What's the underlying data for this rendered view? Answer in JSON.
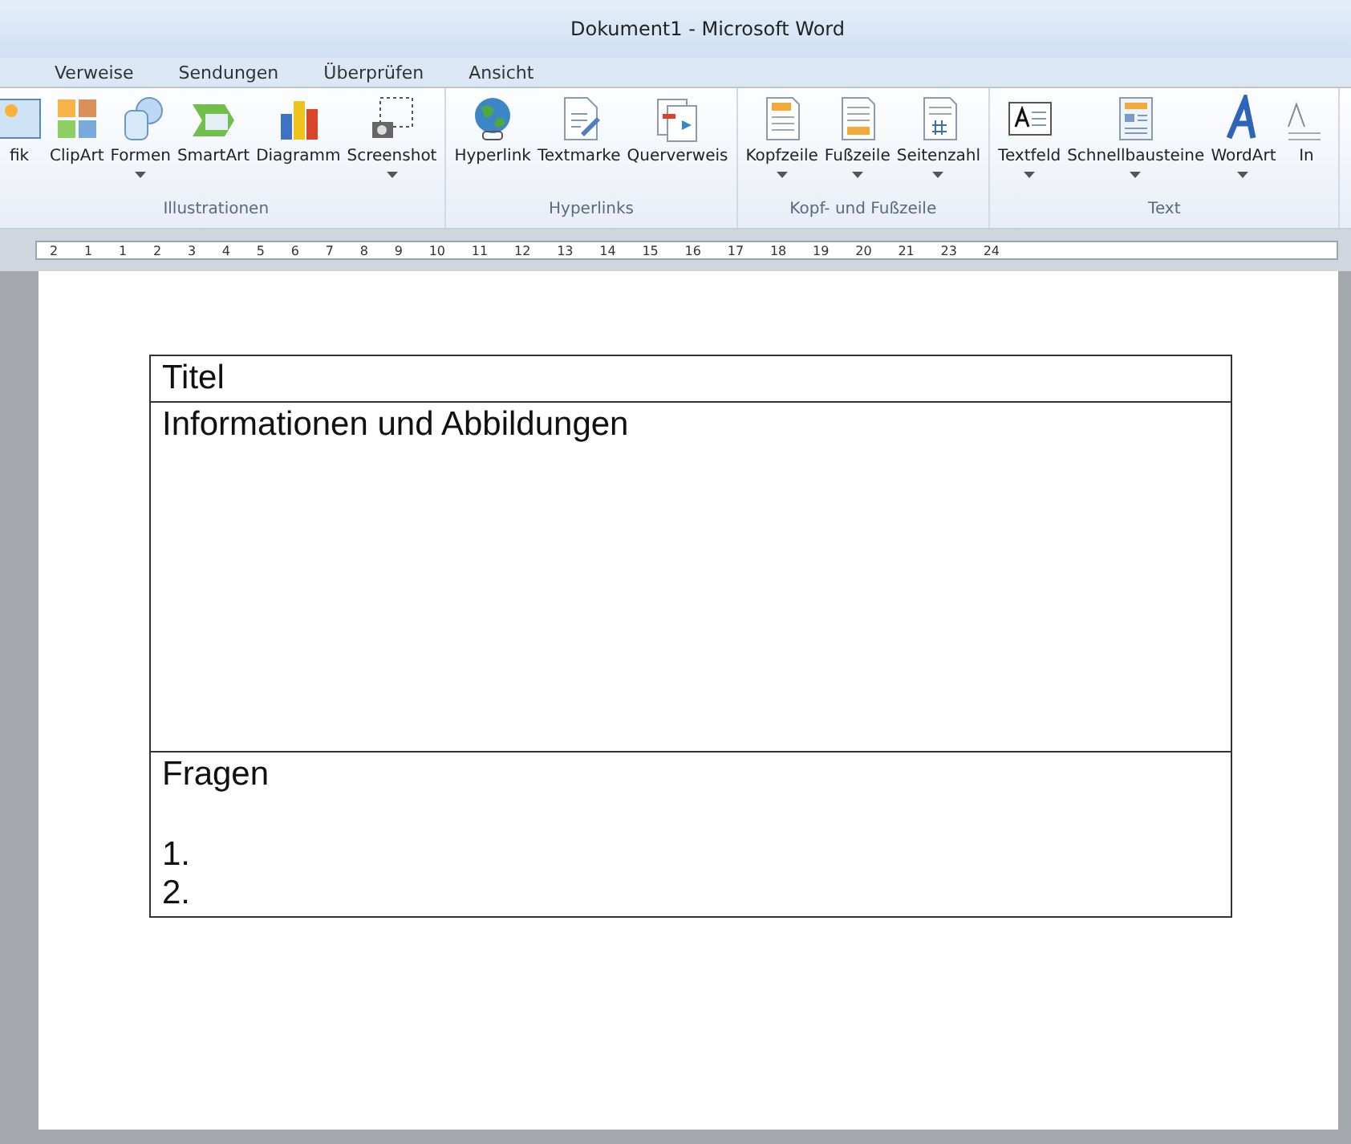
{
  "window": {
    "title": "Dokument1  -  Microsoft Word"
  },
  "tabs": [
    {
      "label": "Verweise",
      "selected": false
    },
    {
      "label": "Sendungen",
      "selected": false
    },
    {
      "label": "Überprüfen",
      "selected": false
    },
    {
      "label": "Ansicht",
      "selected": false
    }
  ],
  "ribbon_groups": [
    {
      "label": "Illustrationen",
      "buttons": [
        {
          "label": "fik",
          "kind": "plain"
        },
        {
          "label": "ClipArt",
          "kind": "plain"
        },
        {
          "label": "Formen",
          "kind": "dropdown"
        },
        {
          "label": "SmartArt",
          "kind": "plain"
        },
        {
          "label": "Diagramm",
          "kind": "plain"
        },
        {
          "label": "Screenshot",
          "kind": "dropdown"
        }
      ]
    },
    {
      "label": "Hyperlinks",
      "buttons": [
        {
          "label": "Hyperlink",
          "kind": "plain"
        },
        {
          "label": "Textmarke",
          "kind": "plain"
        },
        {
          "label": "Querverweis",
          "kind": "plain"
        }
      ]
    },
    {
      "label": "Kopf- und Fußzeile",
      "buttons": [
        {
          "label": "Kopfzeile",
          "kind": "dropdown"
        },
        {
          "label": "Fußzeile",
          "kind": "dropdown"
        },
        {
          "label": "Seitenzahl",
          "kind": "dropdown"
        }
      ]
    },
    {
      "label": "Text",
      "buttons": [
        {
          "label": "Textfeld",
          "kind": "dropdown"
        },
        {
          "label": "Schnellbausteine",
          "kind": "dropdown"
        },
        {
          "label": "WordArt",
          "kind": "dropdown"
        },
        {
          "label": "In",
          "kind": "plain"
        }
      ]
    }
  ],
  "ruler": {
    "labels": [
      "2",
      "1",
      "1",
      "2",
      "3",
      "4",
      "5",
      "6",
      "7",
      "8",
      "9",
      "10",
      "11",
      "12",
      "13",
      "14",
      "15",
      "16",
      "17",
      "18",
      "19",
      "20",
      "21",
      "23",
      "24"
    ]
  },
  "table": {
    "rows": [
      {
        "kind": "title",
        "lines": [
          "Titel"
        ]
      },
      {
        "kind": "body",
        "lines": [
          "Informationen und Abbildungen"
        ]
      },
      {
        "kind": "questions",
        "lines": [
          "Fragen"
        ],
        "items": [
          "1.",
          "2."
        ]
      }
    ]
  }
}
